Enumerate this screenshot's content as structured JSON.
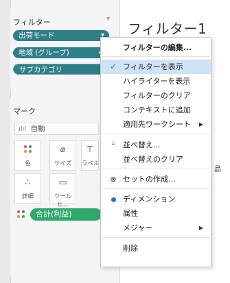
{
  "filters": {
    "title": "フィルター",
    "pills": [
      "出荷モード",
      "地域 (グループ)",
      "サブカテゴリ"
    ]
  },
  "marks": {
    "title": "マーク",
    "mark_type": "自動",
    "tiles": {
      "color": "色",
      "size": "サイズ",
      "label": "ラベル",
      "detail": "詳細",
      "tooltip": "ツールヒ..."
    },
    "measure_pill": "合計(利益)"
  },
  "sheet": {
    "title": "フィルター1",
    "clipped_text": "品"
  },
  "context_menu": {
    "items": [
      "フィルターの編集...",
      "フィルターを表示",
      "ハイライターを表示",
      "フィルターのクリア",
      "コンテキストに追加",
      "適用先ワークシート",
      "並べ替え...",
      "並べ替えのクリア",
      "セットの作成...",
      "ディメンション",
      "属性",
      "メジャー",
      "削除"
    ],
    "highlighted_item": "フィルターを表示"
  },
  "colors": {
    "filter_pill": "#2f7f89",
    "measure_pill": "#2fa86b",
    "menu_highlight": "#cfe3f6",
    "accent": "#2f6bb5"
  },
  "icons": [
    "dropdown-arrow-icon",
    "menu-lines-icon",
    "bar-chart-icon",
    "color-dots-icon",
    "size-icon",
    "text-label-icon",
    "detail-dots-icon",
    "tooltip-icon",
    "checkmark-icon",
    "sort-icon",
    "set-icon",
    "radio-selected-icon",
    "submenu-arrow-icon"
  ]
}
